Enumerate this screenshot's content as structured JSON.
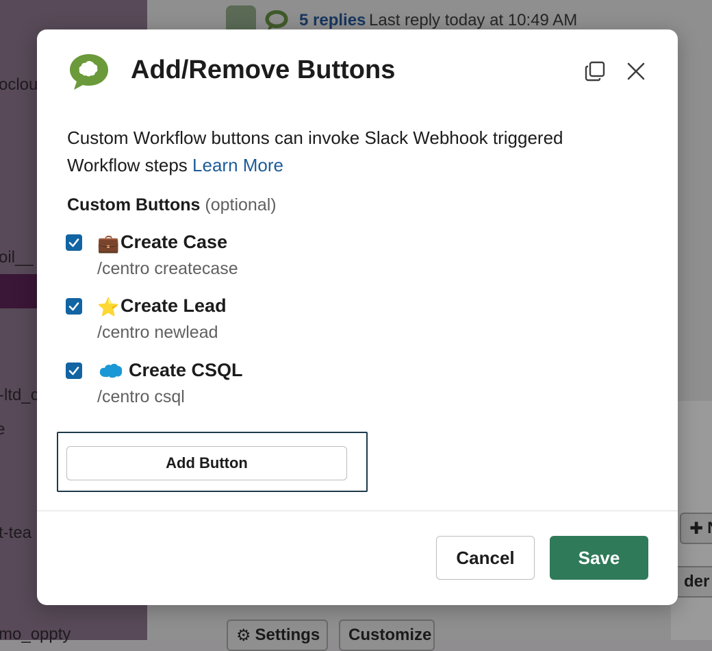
{
  "background": {
    "thread": {
      "replies_label": "5 replies",
      "last_reply": "Last reply today at 10:49 AM"
    },
    "sidebar_fragments": [
      "ocloud",
      "oil__",
      "-ltd_c",
      "e",
      "t-tea",
      "mo_oppty"
    ],
    "toolbar": {
      "settings_label": "Settings",
      "customize_label": "Customize",
      "new_fragment": "N",
      "order_fragment": "der"
    }
  },
  "modal": {
    "title": "Add/Remove Buttons",
    "description": "Custom Workflow buttons can invoke Slack Webhook triggered Workflow steps",
    "learn_more": "Learn More",
    "section_label": "Custom Buttons",
    "section_optional": "(optional)",
    "buttons": [
      {
        "label": "Create Case",
        "command": "/centro createcase",
        "checked": true,
        "icon": "briefcase-icon"
      },
      {
        "label": "Create Lead",
        "command": "/centro newlead",
        "checked": true,
        "icon": "star-icon"
      },
      {
        "label": "Create CSQL",
        "command": "/centro csql",
        "checked": true,
        "icon": "salesforce-cloud-icon"
      }
    ],
    "add_button_label": "Add Button",
    "cancel_label": "Cancel",
    "save_label": "Save"
  },
  "colors": {
    "save_green": "#2f7a59",
    "checkbox_blue": "#1264a3",
    "link_blue": "#1d5c98",
    "app_icon_green": "#6b9a3a"
  }
}
